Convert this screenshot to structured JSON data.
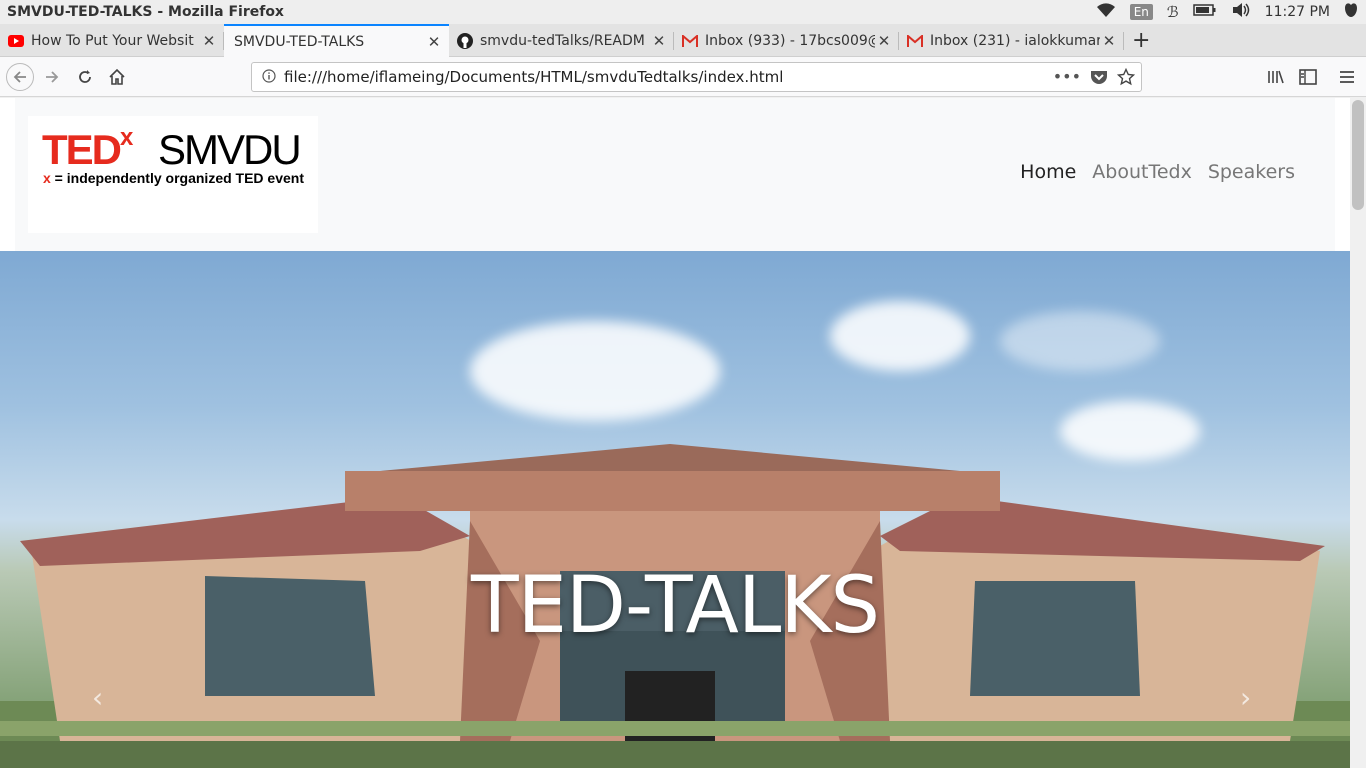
{
  "window": {
    "title": "SMVDU-TED-TALKS - Mozilla Firefox",
    "clock": "11:27 PM",
    "language": "En"
  },
  "tabs": [
    {
      "label": "How To Put Your Websit",
      "favicon": "youtube-icon",
      "active": false
    },
    {
      "label": "SMVDU-TED-TALKS",
      "favicon": "",
      "active": true
    },
    {
      "label": "smvdu-tedTalks/READM",
      "favicon": "github-icon",
      "active": false
    },
    {
      "label": "Inbox (933) - 17bcs009@",
      "favicon": "gmail-icon",
      "active": false
    },
    {
      "label": "Inbox (231) - ialokkumar",
      "favicon": "gmail-icon",
      "active": false
    }
  ],
  "new_tab_label": "+",
  "urlbar": {
    "url": "file:///home/iflameing/Documents/HTML/smvduTedtalks/index.html"
  },
  "site": {
    "logo": {
      "tedx": "TED",
      "x": "x",
      "smvdu": "SMVDU",
      "tag_x": "x",
      "tag_rest": " = independently organized TED event"
    },
    "nav": [
      {
        "label": "Home",
        "active": true
      },
      {
        "label": "AboutTedx",
        "active": false
      },
      {
        "label": "Speakers",
        "active": false
      }
    ],
    "hero_title": "TED-TALKS",
    "prev_label": "‹",
    "next_label": "›"
  },
  "colors": {
    "ted_red": "#e62b1e",
    "tab_accent": "#0a84ff"
  }
}
